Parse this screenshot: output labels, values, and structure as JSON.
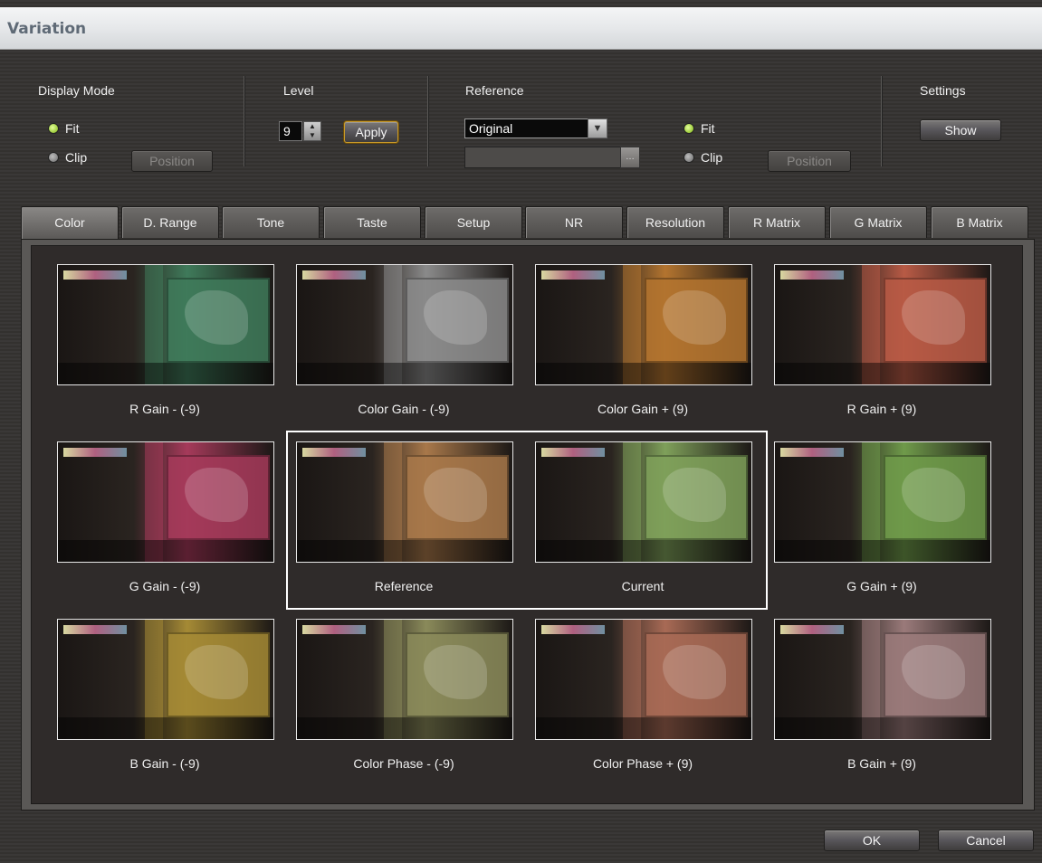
{
  "window": {
    "title": "Variation"
  },
  "display_mode": {
    "label": "Display Mode",
    "fit_label": "Fit",
    "clip_label": "Clip",
    "position_label": "Position",
    "selected": "Fit"
  },
  "level": {
    "label": "Level",
    "value": "9",
    "apply_label": "Apply"
  },
  "reference": {
    "label": "Reference",
    "selected_option": "Original",
    "fit_label": "Fit",
    "clip_label": "Clip",
    "position_label": "Position",
    "selected": "Fit"
  },
  "settings": {
    "label": "Settings",
    "show_label": "Show"
  },
  "tabs": [
    {
      "label": "Color",
      "active": true
    },
    {
      "label": "D. Range"
    },
    {
      "label": "Tone"
    },
    {
      "label": "Taste"
    },
    {
      "label": "Setup"
    },
    {
      "label": "NR"
    },
    {
      "label": "Resolution"
    },
    {
      "label": "R Matrix"
    },
    {
      "label": "G Matrix"
    },
    {
      "label": "B Matrix"
    }
  ],
  "variations": [
    {
      "caption": "R Gain - (-9)",
      "tint": "#3f7a5a"
    },
    {
      "caption": "Color Gain - (-9)",
      "tint": "#8a8a8a"
    },
    {
      "caption": "Color Gain + (9)",
      "tint": "#b3742f"
    },
    {
      "caption": "R Gain + (9)",
      "tint": "#b85a45"
    },
    {
      "caption": "G Gain - (-9)",
      "tint": "#a53a5a"
    },
    {
      "caption": "Reference",
      "tint": "#a8784a"
    },
    {
      "caption": "Current",
      "tint": "#7fa05a"
    },
    {
      "caption": "G Gain + (9)",
      "tint": "#6f9a4a"
    },
    {
      "caption": "B Gain - (-9)",
      "tint": "#a58a35"
    },
    {
      "caption": "Color Phase - (-9)",
      "tint": "#8a8a5a"
    },
    {
      "caption": "Color Phase + (9)",
      "tint": "#a86a55"
    },
    {
      "caption": "B Gain + (9)",
      "tint": "#9a7a7a"
    }
  ],
  "footer": {
    "ok_label": "OK",
    "cancel_label": "Cancel"
  }
}
